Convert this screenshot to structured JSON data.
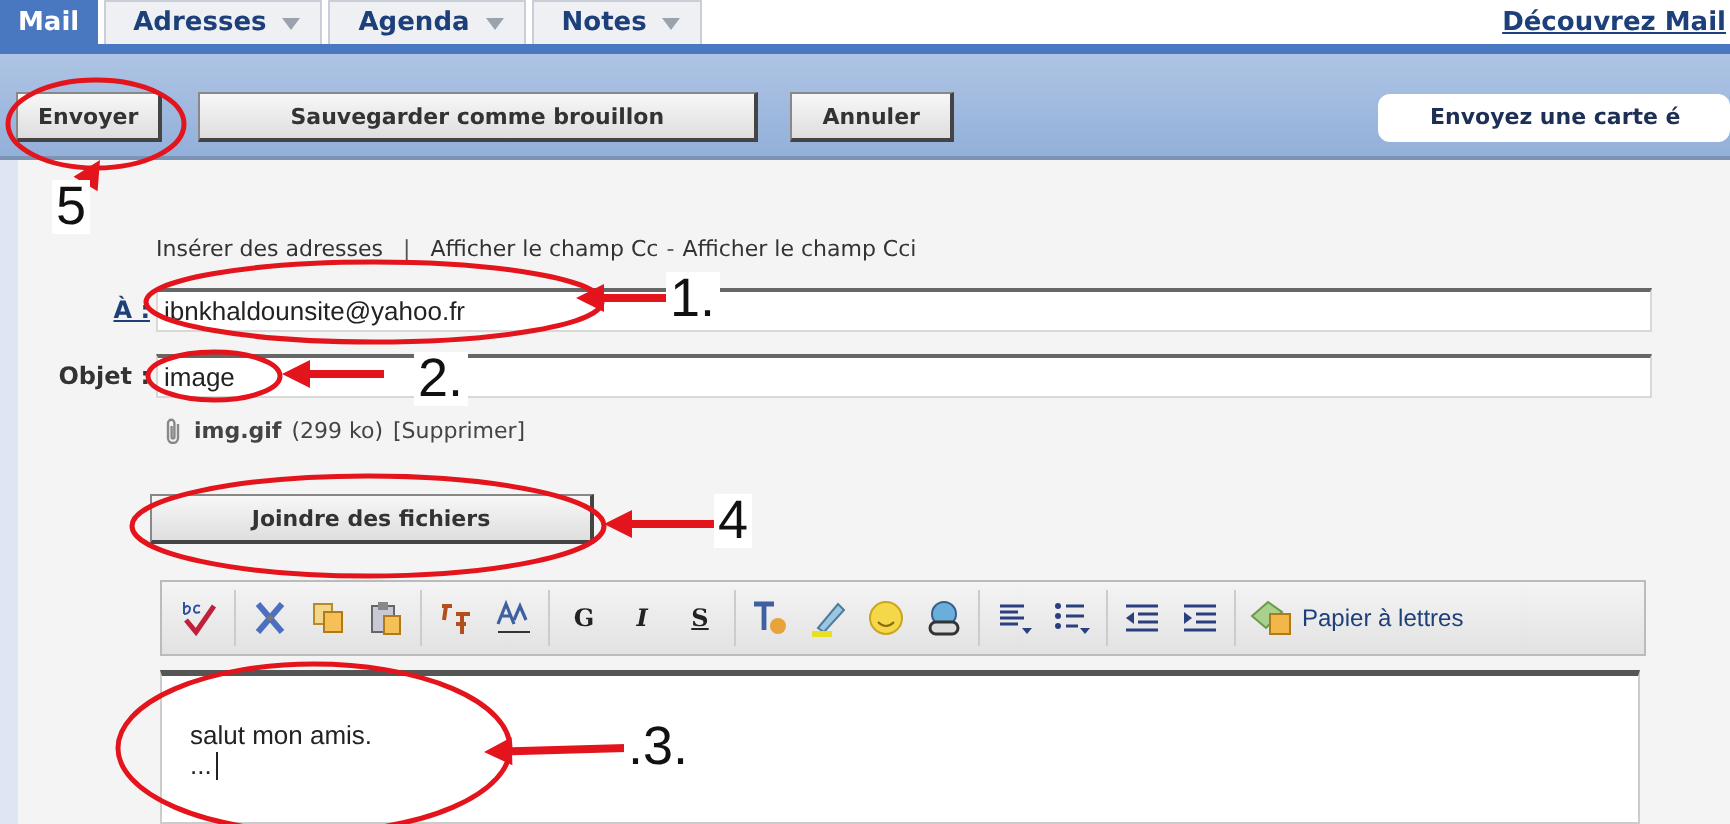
{
  "tabs": [
    {
      "label": "Mail",
      "selected": true,
      "has_menu": false
    },
    {
      "label": "Adresses",
      "selected": false,
      "has_menu": true
    },
    {
      "label": "Agenda",
      "selected": false,
      "has_menu": true
    },
    {
      "label": "Notes",
      "selected": false,
      "has_menu": true
    }
  ],
  "promo_link": "Découvrez Mail",
  "toolbar": {
    "buttons": [
      "Envoyer",
      "Sauvegarder comme brouillon",
      "Annuler"
    ],
    "ecard": "Envoyez une carte é"
  },
  "address_links": [
    {
      "kind": "link",
      "text": "Insérer des adresses"
    },
    {
      "kind": "separator",
      "text": "|"
    },
    {
      "kind": "link",
      "text": "Afficher le champ Cc"
    },
    {
      "kind": "separator",
      "text": "-"
    },
    {
      "kind": "link",
      "text": "Afficher le champ Cci"
    }
  ],
  "fields": [
    {
      "label": "À :",
      "value": "ibnkhaldounsite@yahoo.fr",
      "kind": "link"
    },
    {
      "label": "Objet :",
      "value": "image",
      "kind": "plain"
    }
  ],
  "attachment": {
    "name": "img.gif",
    "size": "(299 ko)",
    "action": "[Supprimer]"
  },
  "attach_button": "Joindre des fichiers",
  "format_buttons": [
    {
      "label": "G",
      "kind": "bold"
    },
    {
      "label": "I",
      "kind": "italic"
    },
    {
      "label": "S",
      "kind": "underline"
    }
  ],
  "stationery_label": "Papier à lettres",
  "editor_lines": [
    "salut mon amis.",
    "..."
  ],
  "annotations": [
    {
      "label": "1."
    },
    {
      "label": "2."
    },
    {
      "label": ".3."
    },
    {
      "label": "4"
    },
    {
      "label": "5"
    }
  ]
}
